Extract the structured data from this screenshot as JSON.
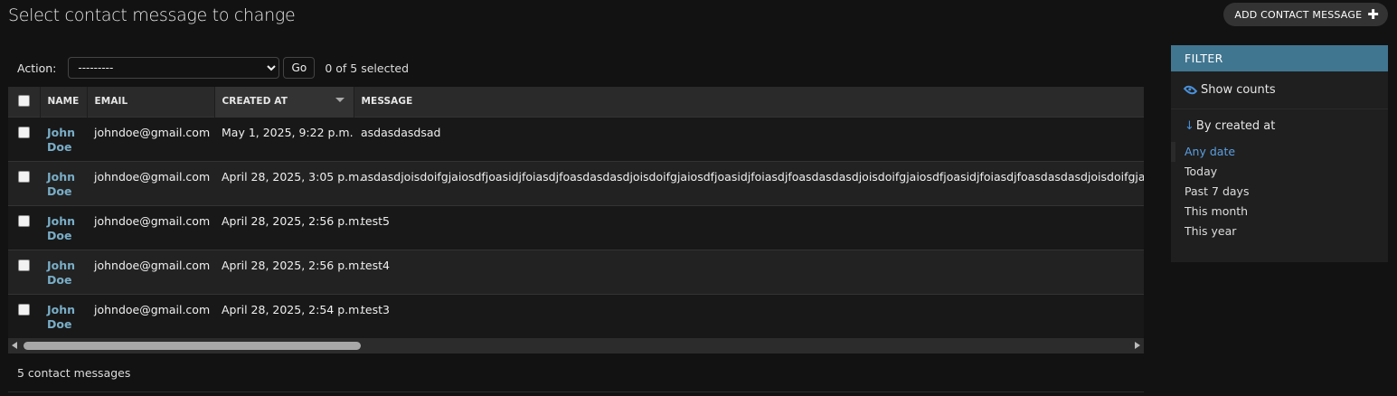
{
  "header": {
    "title": "Select contact message to change",
    "add_label": "ADD CONTACT MESSAGE"
  },
  "actions": {
    "label": "Action:",
    "selected_option": "---------",
    "go_label": "Go",
    "counter": "0 of 5 selected"
  },
  "table": {
    "columns": [
      "Name",
      "Email",
      "Created at",
      "Message"
    ],
    "sorted_column": "Created at",
    "rows": [
      {
        "name": "John Doe",
        "email": "johndoe@gmail.com",
        "created_at": "May 1, 2025, 9:22 p.m.",
        "message": "asdasdasdsad"
      },
      {
        "name": "John Doe",
        "email": "johndoe@gmail.com",
        "created_at": "April 28, 2025, 3:05 p.m.",
        "message": "asdasdjoisdoifgjaiosdfjoasidjfoiasdjfoasdasdasdjoisdoifgjaiosdfjoasidjfoiasdjfoasdasdasdjoisdoifgjaiosdfjoasidjfoiasdjfoasdasdasdjoisdoifgjaiosdfjoasidjfo"
      },
      {
        "name": "John Doe",
        "email": "johndoe@gmail.com",
        "created_at": "April 28, 2025, 2:56 p.m.",
        "message": "test5"
      },
      {
        "name": "John Doe",
        "email": "johndoe@gmail.com",
        "created_at": "April 28, 2025, 2:56 p.m.",
        "message": "test4"
      },
      {
        "name": "John Doe",
        "email": "johndoe@gmail.com",
        "created_at": "April 28, 2025, 2:54 p.m.",
        "message": "test3"
      }
    ]
  },
  "paginator": {
    "text": "5 contact messages"
  },
  "filter": {
    "title": "FILTER",
    "show_counts": "Show counts",
    "by_label": "By created at",
    "options": [
      "Any date",
      "Today",
      "Past 7 days",
      "This month",
      "This year"
    ],
    "selected": "Any date"
  },
  "colors": {
    "background": "#121212",
    "link": "#79aec8",
    "filter_header": "#417690"
  }
}
